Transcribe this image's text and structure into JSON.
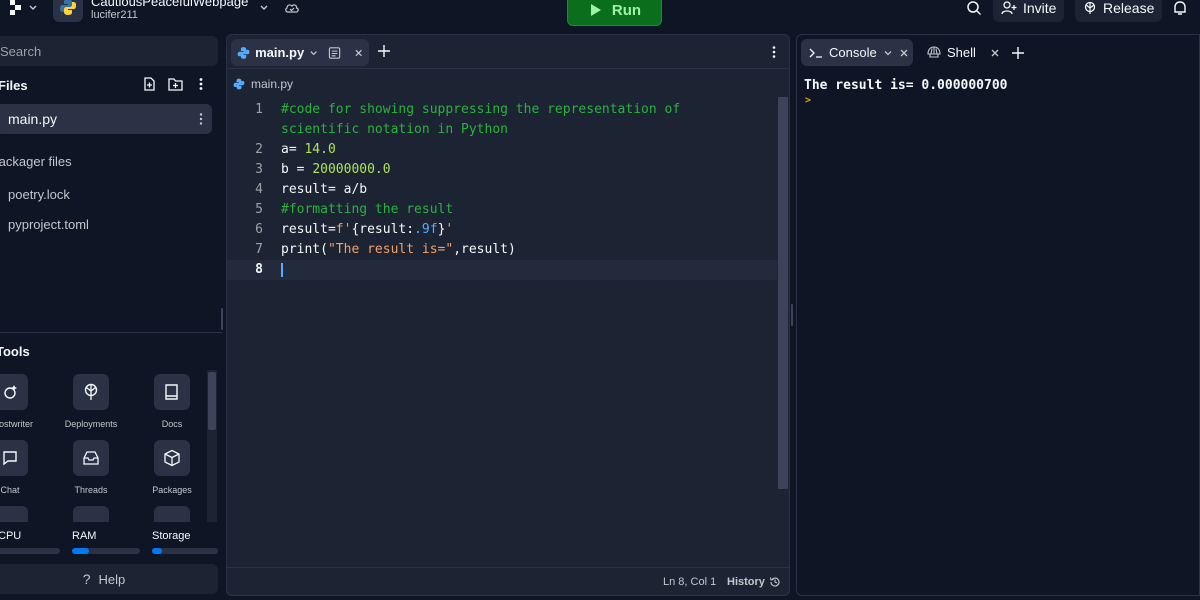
{
  "topbar": {
    "project_name": "CautiousPeacefulWebpage",
    "user": "lucifer211",
    "run_label": "Run",
    "invite_label": "Invite",
    "release_label": "Release"
  },
  "sidebar": {
    "search_placeholder": "Search",
    "files_title": "Files",
    "files": [
      {
        "label": "main.py"
      }
    ],
    "packager_title": "Packager files",
    "packager_files": [
      {
        "label": "poetry.lock"
      },
      {
        "label": "pyproject.toml"
      }
    ],
    "tools_title": "Tools",
    "tools": [
      {
        "label": "Ghostwriter",
        "icon": "ghostwriter-icon"
      },
      {
        "label": "Deployments",
        "icon": "deployments-icon"
      },
      {
        "label": "Docs",
        "icon": "docs-icon"
      },
      {
        "label": "Chat",
        "icon": "chat-icon"
      },
      {
        "label": "Threads",
        "icon": "threads-icon"
      },
      {
        "label": "Packages",
        "icon": "packages-icon"
      }
    ],
    "resources": [
      {
        "label": "CPU",
        "usage": 0.0
      },
      {
        "label": "RAM",
        "usage": 0.25
      },
      {
        "label": "Storage",
        "usage": 0.15
      }
    ],
    "help_label": "Help"
  },
  "editor": {
    "tab_label": "main.py",
    "breadcrumb": "main.py",
    "line_numbers": [
      "1",
      "2",
      "3",
      "4",
      "5",
      "6",
      "7",
      "8"
    ],
    "code": {
      "l1a": "#code for showing suppressing the representation of",
      "l1b": "scientific notation in Python",
      "l2_var": "a= ",
      "l2_num": "14.0",
      "l3_var": "b = ",
      "l3_num": "20000000.0",
      "l4": "result= a/b",
      "l5": "#formatting the result",
      "l6_pre": "result=",
      "l6_str1": "f'",
      "l6_mid": "{result:",
      "l6_fmt": ".9f",
      "l6_end": "}",
      "l6_str2": "'",
      "l7_fn": "print(",
      "l7_str": "\"The result is=\"",
      "l7_end": ",result)"
    },
    "status_position": "Ln 8, Col 1",
    "history_label": "History"
  },
  "console": {
    "tab_console": "Console",
    "tab_shell": "Shell",
    "output": "The result is= 0.000000700",
    "prompt": ">"
  },
  "colors": {
    "background": "#0e1525",
    "panel": "#1c2333",
    "run_button": "#0a6e1c",
    "comment": "#29b33c",
    "number": "#b0e356",
    "string": "#f2a067",
    "accent": "#0079f2"
  }
}
